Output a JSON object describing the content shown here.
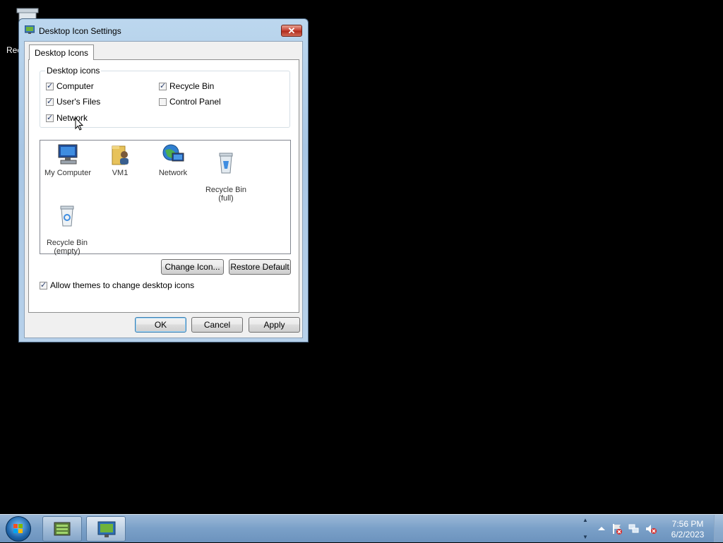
{
  "desktop": {
    "recycle_label": "Rec"
  },
  "window": {
    "title": "Desktop Icon Settings",
    "close_glyph": "✕",
    "tab_label": "Desktop Icons",
    "group_title": "Desktop icons",
    "checkboxes": [
      {
        "label": "Computer",
        "checked": true
      },
      {
        "label": "Recycle Bin",
        "checked": true
      },
      {
        "label": "User's Files",
        "checked": true
      },
      {
        "label": "Control Panel",
        "checked": false
      },
      {
        "label": "Network",
        "checked": true
      }
    ],
    "icons": [
      {
        "label": "My Computer",
        "icon": "computer-icon"
      },
      {
        "label": "VM1",
        "icon": "user-folder-icon"
      },
      {
        "label": "Network",
        "icon": "network-icon"
      },
      {
        "label": "Recycle Bin\n(full)",
        "icon": "recycle-bin-full-icon"
      },
      {
        "label": "Recycle Bin\n(empty)",
        "icon": "recycle-bin-empty-icon"
      }
    ],
    "change_icon_label": "Change Icon...",
    "restore_default_label": "Restore Default",
    "allow_themes_label": "Allow themes to change desktop icons",
    "allow_themes_checked": true,
    "ok_label": "OK",
    "cancel_label": "Cancel",
    "apply_label": "Apply"
  },
  "taskbar": {
    "time": "7:56 PM",
    "date": "6/2/2023",
    "tray_icons": [
      "action-center-icon",
      "network-tray-icon",
      "volume-muted-icon"
    ]
  },
  "colors": {
    "accent": "#3c7fb1",
    "close_red": "#c8483a",
    "taskbar": "#7aa0c8"
  }
}
